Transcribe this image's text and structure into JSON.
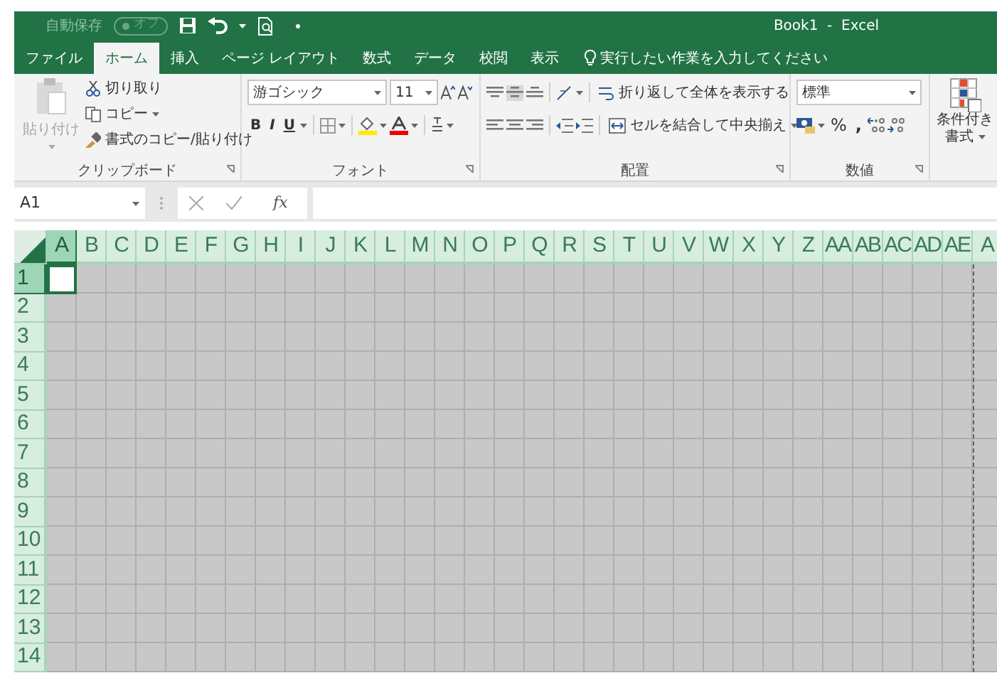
{
  "title_bar": {
    "autosave_label": "自動保存",
    "autosave_state": "オフ",
    "autosave_on": false,
    "title": "Book1  -  Excel"
  },
  "tabs": [
    {
      "label": "ファイル",
      "selected": false
    },
    {
      "label": "ホーム",
      "selected": true
    },
    {
      "label": "挿入",
      "selected": false
    },
    {
      "label": "ページ レイアウト",
      "selected": false
    },
    {
      "label": "数式",
      "selected": false
    },
    {
      "label": "データ",
      "selected": false
    },
    {
      "label": "校閲",
      "selected": false
    },
    {
      "label": "表示",
      "selected": false
    }
  ],
  "tell_me": {
    "placeholder": "実行したい作業を入力してください"
  },
  "clipboard": {
    "paste": "貼り付け",
    "paste_disabled": true,
    "cut": "切り取り",
    "copy": "コピー",
    "format_painter": "書式のコピー/貼り付け",
    "label": "クリップボード"
  },
  "font": {
    "font_name": "游ゴシック",
    "font_size": "11",
    "bold": "B",
    "italic": "I",
    "underline": "U",
    "label": "フォント"
  },
  "alignment": {
    "wrap_text": "折り返して全体を表示する",
    "merge_center": "セルを結合して中央揃え",
    "label": "配置"
  },
  "number": {
    "format": "標準",
    "percent": "%",
    "comma": ",",
    "label": "数値"
  },
  "styles": {
    "conditional_formatting": [
      "条件付き",
      "書式"
    ]
  },
  "formula_bar": {
    "name_box": "A1",
    "function_label": "fx"
  },
  "sheet": {
    "columns": [
      {
        "label": "A",
        "selected": true
      },
      {
        "label": "B",
        "selected": false
      },
      {
        "label": "C",
        "selected": false
      },
      {
        "label": "D",
        "selected": false
      },
      {
        "label": "E",
        "selected": false
      },
      {
        "label": "F",
        "selected": false
      },
      {
        "label": "G",
        "selected": false
      },
      {
        "label": "H",
        "selected": false
      },
      {
        "label": "I",
        "selected": false
      },
      {
        "label": "J",
        "selected": false
      },
      {
        "label": "K",
        "selected": false
      },
      {
        "label": "L",
        "selected": false
      },
      {
        "label": "M",
        "selected": false
      },
      {
        "label": "N",
        "selected": false
      },
      {
        "label": "O",
        "selected": false
      },
      {
        "label": "P",
        "selected": false
      },
      {
        "label": "Q",
        "selected": false
      },
      {
        "label": "R",
        "selected": false
      },
      {
        "label": "S",
        "selected": false
      },
      {
        "label": "T",
        "selected": false
      },
      {
        "label": "U",
        "selected": false
      },
      {
        "label": "V",
        "selected": false
      },
      {
        "label": "W",
        "selected": false
      },
      {
        "label": "X",
        "selected": false
      },
      {
        "label": "Y",
        "selected": false
      },
      {
        "label": "Z",
        "selected": false
      },
      {
        "label": "AA",
        "selected": false
      },
      {
        "label": "AB",
        "selected": false
      },
      {
        "label": "AC",
        "selected": false
      },
      {
        "label": "AD",
        "selected": false
      },
      {
        "label": "AE",
        "selected": false
      },
      {
        "label": "A",
        "selected": false
      }
    ],
    "rows": [
      {
        "label": "1",
        "selected": true
      },
      {
        "label": "2",
        "selected": false
      },
      {
        "label": "3",
        "selected": false
      },
      {
        "label": "4",
        "selected": false
      },
      {
        "label": "5",
        "selected": false
      },
      {
        "label": "6",
        "selected": false
      },
      {
        "label": "7",
        "selected": false
      },
      {
        "label": "8",
        "selected": false
      },
      {
        "label": "9",
        "selected": false
      },
      {
        "label": "10",
        "selected": false
      },
      {
        "label": "11",
        "selected": false
      },
      {
        "label": "12",
        "selected": false
      },
      {
        "label": "13",
        "selected": false
      },
      {
        "label": "14",
        "selected": false
      }
    ]
  }
}
